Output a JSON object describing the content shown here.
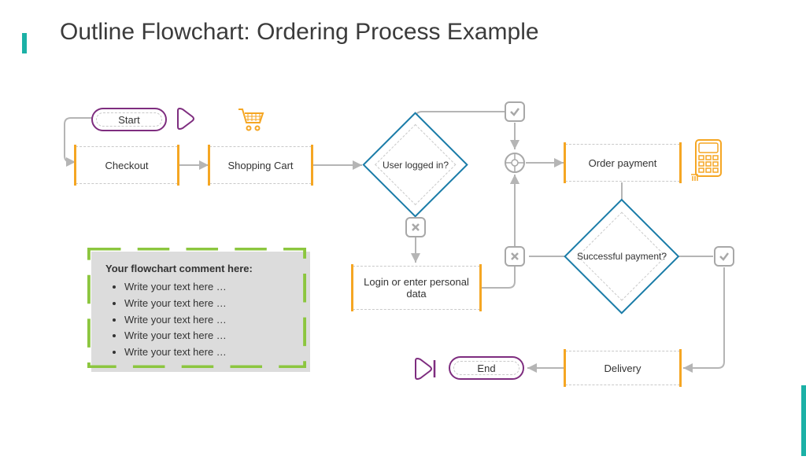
{
  "title": "Outline Flowchart: Ordering Process Example",
  "nodes": {
    "start": "Start",
    "checkout": "Checkout",
    "cart": "Shopping Cart",
    "decision1": "User logged in?",
    "login": "Login or enter personal data",
    "order_payment": "Order payment",
    "decision2": "Successful payment?",
    "delivery": "Delivery",
    "end": "End"
  },
  "comment": {
    "heading": "Your flowchart comment here:",
    "items": [
      "Write your text here …",
      "Write your text here …",
      "Write your text here …",
      "Write your text here …",
      "Write your text here …"
    ]
  },
  "icons": {
    "play": "play-icon",
    "cart": "cart-icon",
    "check": "check-icon",
    "cross": "cross-icon",
    "merge": "merge-icon",
    "terminal": "pos-terminal-icon",
    "stop": "stop-icon"
  }
}
